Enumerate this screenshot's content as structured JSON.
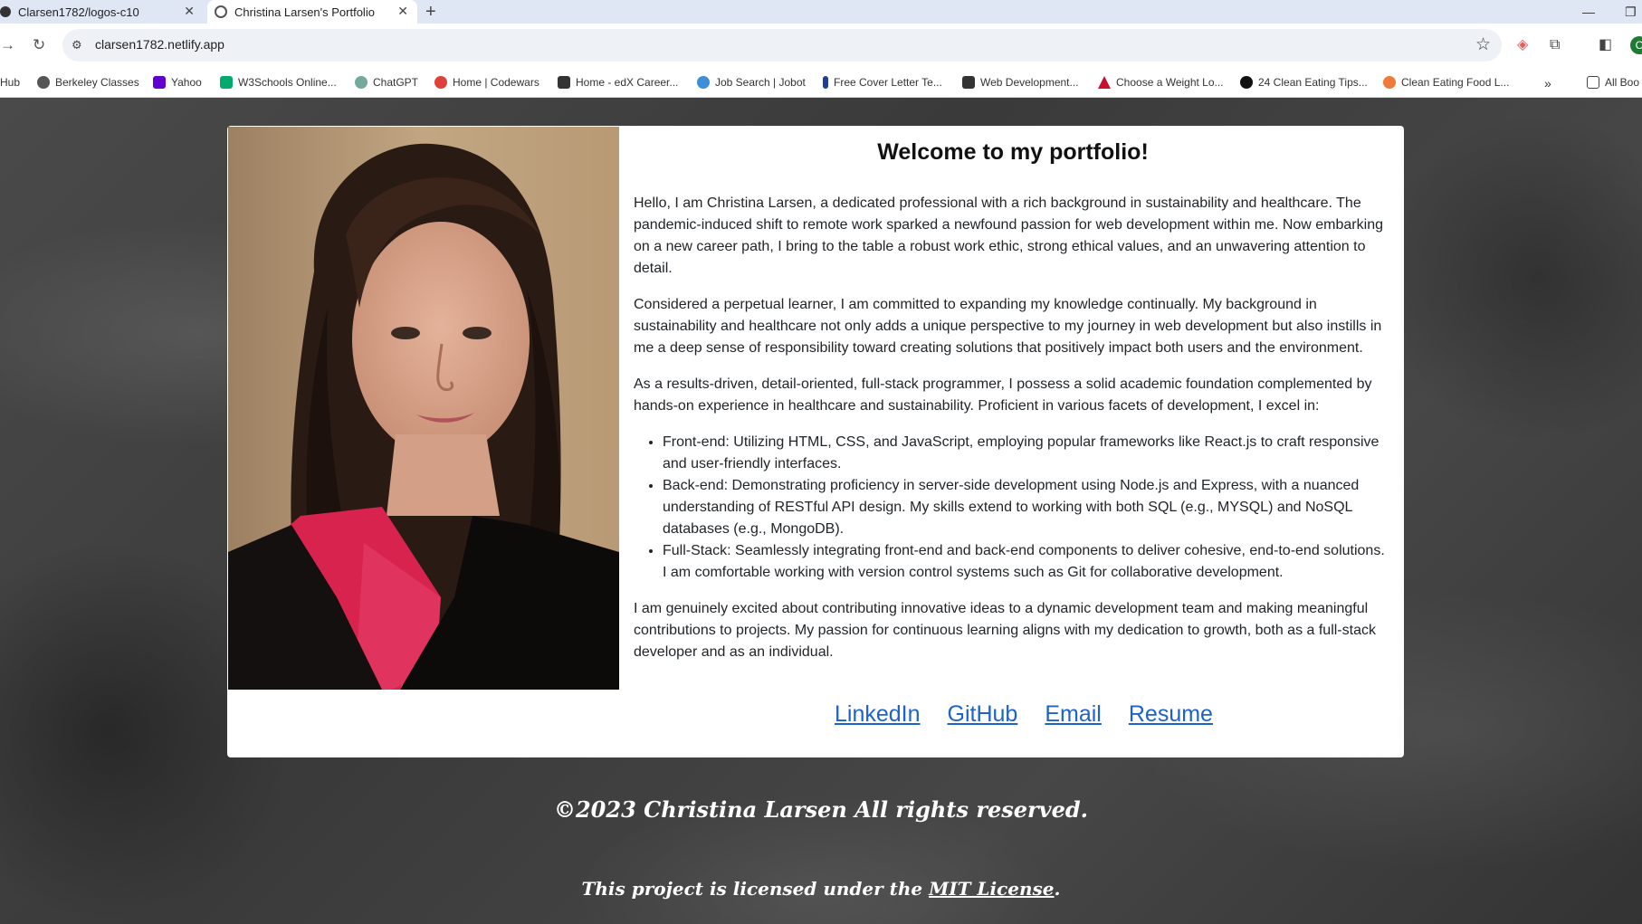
{
  "browser": {
    "tabs": [
      {
        "title": "Clarsen1782/logos-c10"
      },
      {
        "title": "Christina Larsen's Portfolio"
      }
    ],
    "new_tab": "+",
    "url": "clarsen1782.netlify.app",
    "bookmarks": [
      {
        "label": "Hub"
      },
      {
        "label": "Berkeley Classes"
      },
      {
        "label": "Yahoo"
      },
      {
        "label": "W3Schools Online..."
      },
      {
        "label": "ChatGPT"
      },
      {
        "label": "Home | Codewars"
      },
      {
        "label": "Home - edX Career..."
      },
      {
        "label": "Job Search | Jobot"
      },
      {
        "label": "Free Cover Letter Te..."
      },
      {
        "label": "Web Development..."
      },
      {
        "label": "Choose a Weight Lo..."
      },
      {
        "label": "24 Clean Eating Tips..."
      },
      {
        "label": "Clean Eating Food L..."
      }
    ],
    "all_bookmarks": "All Boo",
    "profile_initial": "C",
    "colors": {
      "tab_strip": "#dfe7f5",
      "accent": "#1e63c8"
    }
  },
  "portfolio": {
    "heading": "Welcome to my portfolio!",
    "paragraphs": [
      "Hello, I am Christina Larsen, a dedicated professional with a rich background in sustainability and healthcare. The pandemic-induced shift to remote work sparked a newfound passion for web development within me. Now embarking on a new career path, I bring to the table a robust work ethic, strong ethical values, and an unwavering attention to detail.",
      "Considered a perpetual learner, I am committed to expanding my knowledge continually. My background in sustainability and healthcare not only adds a unique perspective to my journey in web development but also instills in me a deep sense of responsibility toward creating solutions that positively impact both users and the environment.",
      "As a results-driven, detail-oriented, full-stack programmer, I possess a solid academic foundation complemented by hands-on experience in healthcare and sustainability. Proficient in various facets of development, I excel in:"
    ],
    "skills": [
      "Front-end: Utilizing HTML, CSS, and JavaScript, employing popular frameworks like React.js to craft responsive and user-friendly interfaces.",
      "Back-end: Demonstrating proficiency in server-side development using Node.js and Express, with a nuanced understanding of RESTful API design. My skills extend to working with both SQL (e.g., MYSQL) and NoSQL databases (e.g., MongoDB).",
      "Full-Stack: Seamlessly integrating front-end and back-end components to deliver cohesive, end-to-end solutions. I am comfortable working with version control systems such as Git for collaborative development."
    ],
    "closing": "I am genuinely excited about contributing innovative ideas to a dynamic development team and making meaningful contributions to projects. My passion for continuous learning aligns with my dedication to growth, both as a full-stack developer and as an individual.",
    "links": {
      "linkedin": "LinkedIn",
      "github": "GitHub",
      "email": "Email",
      "resume": "Resume"
    }
  },
  "footer": {
    "copyright": "©2023 Christina Larsen All rights reserved.",
    "license_prefix": "This project is licensed under the ",
    "license_link": "MIT License",
    "license_suffix": "."
  }
}
